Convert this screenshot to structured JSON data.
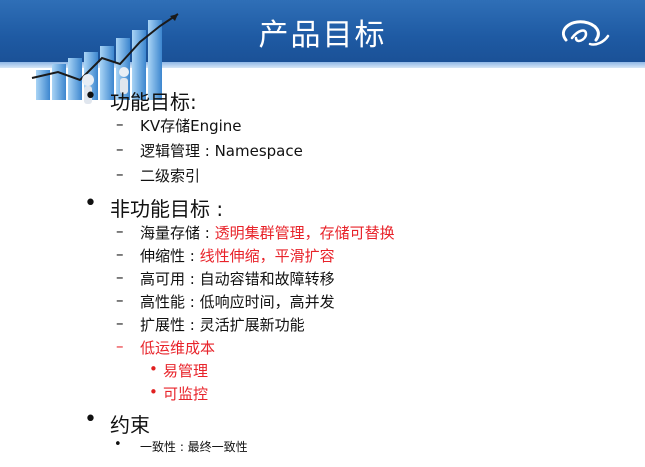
{
  "slide": {
    "title": "产品目标"
  },
  "sections": {
    "func": {
      "title": "功能目标:",
      "items": [
        "KV存储Engine",
        "逻辑管理 : Namespace",
        "二级索引"
      ]
    },
    "nonfunc": {
      "title": "非功能目标 :",
      "items": [
        {
          "label": "海量存储 : ",
          "value": "透明集群管理，存储可替换",
          "value_color": "red"
        },
        {
          "label": "伸缩性 : ",
          "value": "线性伸缩，平滑扩容",
          "value_color": "red"
        },
        {
          "label": "高可用 : ",
          "value": "自动容错和故障转移",
          "value_color": "black"
        },
        {
          "label": "高性能 : ",
          "value": "低响应时间，高并发",
          "value_color": "black"
        },
        {
          "label": "扩展性 : ",
          "value": "灵活扩展新功能",
          "value_color": "black"
        }
      ],
      "lowcost": {
        "title": "低运维成本",
        "subitems": [
          "易管理",
          "可监控"
        ]
      }
    },
    "constraint": {
      "title": "约束",
      "items": [
        "一致性 : 最终一致性"
      ]
    }
  },
  "colors": {
    "header": "#1e5aa3",
    "accent_red": "#e8232a"
  },
  "icons": {
    "logo": "alibaba-logo-icon",
    "deco": "bar-chart-growth-icon"
  }
}
